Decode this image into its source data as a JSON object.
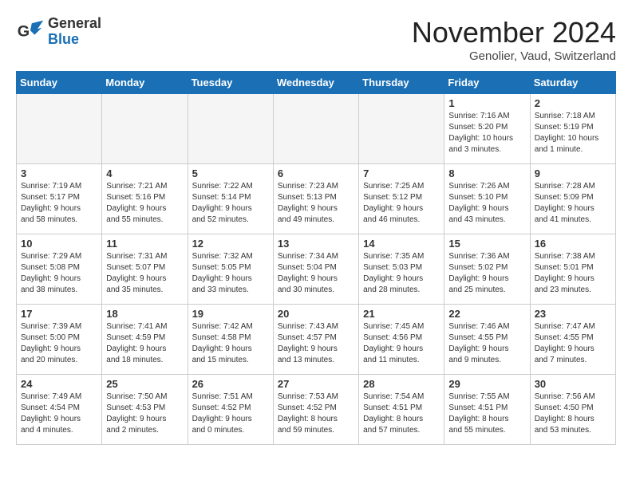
{
  "header": {
    "logo_line1": "General",
    "logo_line2": "Blue",
    "month_title": "November 2024",
    "location": "Genolier, Vaud, Switzerland"
  },
  "weekdays": [
    "Sunday",
    "Monday",
    "Tuesday",
    "Wednesday",
    "Thursday",
    "Friday",
    "Saturday"
  ],
  "weeks": [
    [
      {
        "day": "",
        "info": ""
      },
      {
        "day": "",
        "info": ""
      },
      {
        "day": "",
        "info": ""
      },
      {
        "day": "",
        "info": ""
      },
      {
        "day": "",
        "info": ""
      },
      {
        "day": "1",
        "info": "Sunrise: 7:16 AM\nSunset: 5:20 PM\nDaylight: 10 hours\nand 3 minutes."
      },
      {
        "day": "2",
        "info": "Sunrise: 7:18 AM\nSunset: 5:19 PM\nDaylight: 10 hours\nand 1 minute."
      }
    ],
    [
      {
        "day": "3",
        "info": "Sunrise: 7:19 AM\nSunset: 5:17 PM\nDaylight: 9 hours\nand 58 minutes."
      },
      {
        "day": "4",
        "info": "Sunrise: 7:21 AM\nSunset: 5:16 PM\nDaylight: 9 hours\nand 55 minutes."
      },
      {
        "day": "5",
        "info": "Sunrise: 7:22 AM\nSunset: 5:14 PM\nDaylight: 9 hours\nand 52 minutes."
      },
      {
        "day": "6",
        "info": "Sunrise: 7:23 AM\nSunset: 5:13 PM\nDaylight: 9 hours\nand 49 minutes."
      },
      {
        "day": "7",
        "info": "Sunrise: 7:25 AM\nSunset: 5:12 PM\nDaylight: 9 hours\nand 46 minutes."
      },
      {
        "day": "8",
        "info": "Sunrise: 7:26 AM\nSunset: 5:10 PM\nDaylight: 9 hours\nand 43 minutes."
      },
      {
        "day": "9",
        "info": "Sunrise: 7:28 AM\nSunset: 5:09 PM\nDaylight: 9 hours\nand 41 minutes."
      }
    ],
    [
      {
        "day": "10",
        "info": "Sunrise: 7:29 AM\nSunset: 5:08 PM\nDaylight: 9 hours\nand 38 minutes."
      },
      {
        "day": "11",
        "info": "Sunrise: 7:31 AM\nSunset: 5:07 PM\nDaylight: 9 hours\nand 35 minutes."
      },
      {
        "day": "12",
        "info": "Sunrise: 7:32 AM\nSunset: 5:05 PM\nDaylight: 9 hours\nand 33 minutes."
      },
      {
        "day": "13",
        "info": "Sunrise: 7:34 AM\nSunset: 5:04 PM\nDaylight: 9 hours\nand 30 minutes."
      },
      {
        "day": "14",
        "info": "Sunrise: 7:35 AM\nSunset: 5:03 PM\nDaylight: 9 hours\nand 28 minutes."
      },
      {
        "day": "15",
        "info": "Sunrise: 7:36 AM\nSunset: 5:02 PM\nDaylight: 9 hours\nand 25 minutes."
      },
      {
        "day": "16",
        "info": "Sunrise: 7:38 AM\nSunset: 5:01 PM\nDaylight: 9 hours\nand 23 minutes."
      }
    ],
    [
      {
        "day": "17",
        "info": "Sunrise: 7:39 AM\nSunset: 5:00 PM\nDaylight: 9 hours\nand 20 minutes."
      },
      {
        "day": "18",
        "info": "Sunrise: 7:41 AM\nSunset: 4:59 PM\nDaylight: 9 hours\nand 18 minutes."
      },
      {
        "day": "19",
        "info": "Sunrise: 7:42 AM\nSunset: 4:58 PM\nDaylight: 9 hours\nand 15 minutes."
      },
      {
        "day": "20",
        "info": "Sunrise: 7:43 AM\nSunset: 4:57 PM\nDaylight: 9 hours\nand 13 minutes."
      },
      {
        "day": "21",
        "info": "Sunrise: 7:45 AM\nSunset: 4:56 PM\nDaylight: 9 hours\nand 11 minutes."
      },
      {
        "day": "22",
        "info": "Sunrise: 7:46 AM\nSunset: 4:55 PM\nDaylight: 9 hours\nand 9 minutes."
      },
      {
        "day": "23",
        "info": "Sunrise: 7:47 AM\nSunset: 4:55 PM\nDaylight: 9 hours\nand 7 minutes."
      }
    ],
    [
      {
        "day": "24",
        "info": "Sunrise: 7:49 AM\nSunset: 4:54 PM\nDaylight: 9 hours\nand 4 minutes."
      },
      {
        "day": "25",
        "info": "Sunrise: 7:50 AM\nSunset: 4:53 PM\nDaylight: 9 hours\nand 2 minutes."
      },
      {
        "day": "26",
        "info": "Sunrise: 7:51 AM\nSunset: 4:52 PM\nDaylight: 9 hours\nand 0 minutes."
      },
      {
        "day": "27",
        "info": "Sunrise: 7:53 AM\nSunset: 4:52 PM\nDaylight: 8 hours\nand 59 minutes."
      },
      {
        "day": "28",
        "info": "Sunrise: 7:54 AM\nSunset: 4:51 PM\nDaylight: 8 hours\nand 57 minutes."
      },
      {
        "day": "29",
        "info": "Sunrise: 7:55 AM\nSunset: 4:51 PM\nDaylight: 8 hours\nand 55 minutes."
      },
      {
        "day": "30",
        "info": "Sunrise: 7:56 AM\nSunset: 4:50 PM\nDaylight: 8 hours\nand 53 minutes."
      }
    ]
  ]
}
